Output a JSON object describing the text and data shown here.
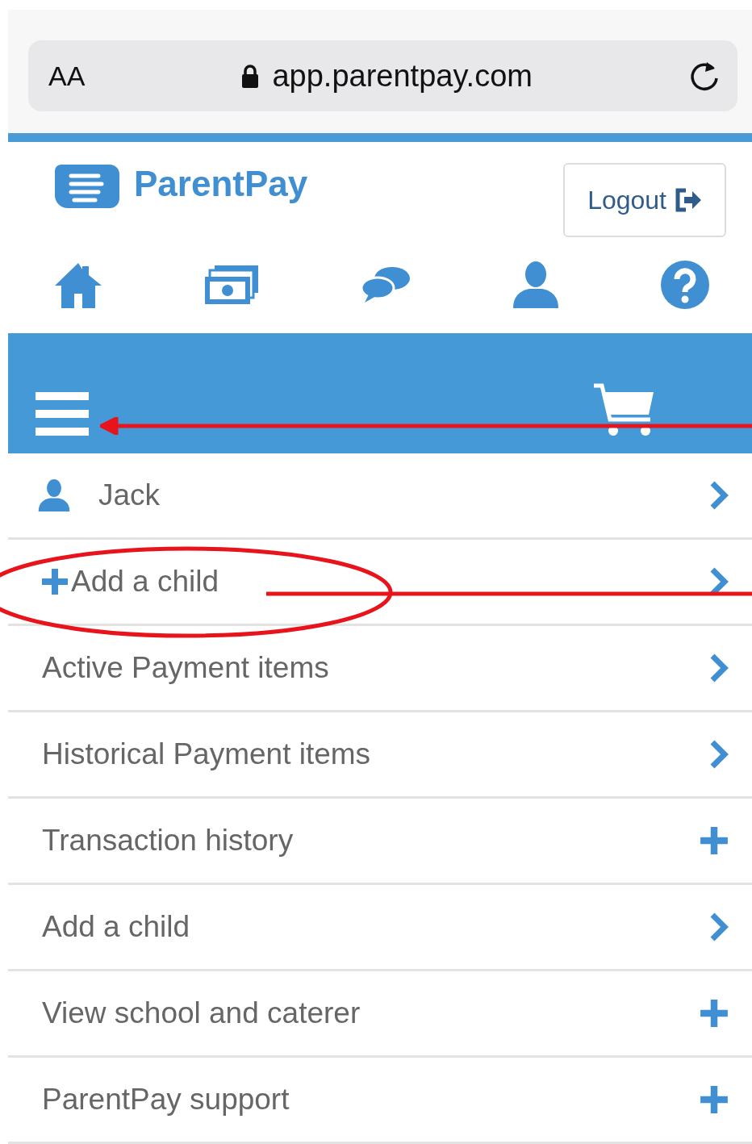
{
  "browser": {
    "text_size": "AA",
    "url": "app.parentpay.com"
  },
  "header": {
    "brand": "ParentPay",
    "logout": "Logout"
  },
  "menu": [
    {
      "label": "Jack",
      "kind": "child"
    },
    {
      "label": "Add a child",
      "kind": "add"
    },
    {
      "label": "Active Payment items",
      "kind": "link"
    },
    {
      "label": "Historical Payment items",
      "kind": "link"
    },
    {
      "label": "Transaction history",
      "kind": "expander"
    },
    {
      "label": "Add a child",
      "kind": "link"
    },
    {
      "label": "View school and caterer",
      "kind": "expander"
    },
    {
      "label": "ParentPay support",
      "kind": "expander"
    }
  ]
}
